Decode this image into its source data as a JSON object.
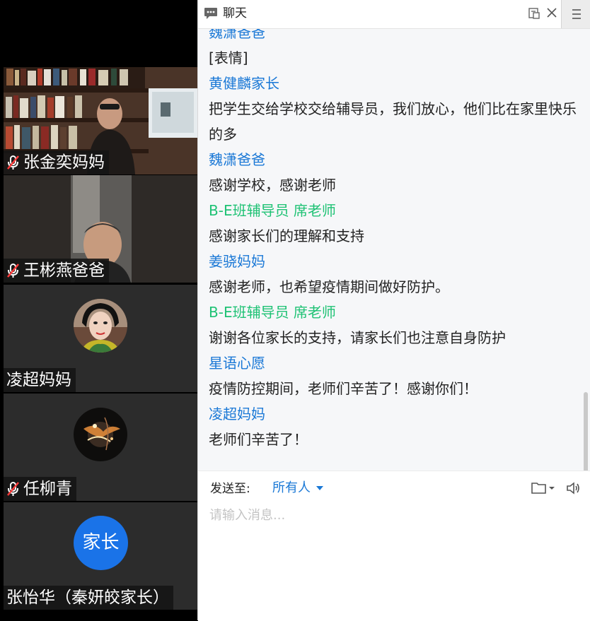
{
  "participants": [
    {
      "name": "张金奕妈妈",
      "muted": true,
      "video": "bookshelf"
    },
    {
      "name": "王彬燕爸爸",
      "muted": true,
      "video": "camera"
    },
    {
      "name": "凌超妈妈",
      "muted": false,
      "video": "avatar"
    },
    {
      "name": "任柳青",
      "muted": true,
      "video": "avatar"
    },
    {
      "name": "张怡华（秦妍皎家长）",
      "muted": false,
      "video": "badge",
      "badge": "家长"
    }
  ],
  "chat": {
    "title": "聊天",
    "messages": [
      {
        "sender": "魏潇爸爸",
        "text": "[表情]"
      },
      {
        "sender": "黄健麟家长",
        "text": "把学生交给学校交给辅导员，我们放心，他们比在家里快乐的多"
      },
      {
        "sender": "魏潇爸爸",
        "text": "感谢学校，感谢老师"
      },
      {
        "sender": "B-E班辅导员 席老师",
        "text": "感谢家长们的理解和支持"
      },
      {
        "sender": "姜骁妈妈",
        "text": "感谢老师，也希望疫情期间做好防护。"
      },
      {
        "sender": "B-E班辅导员 席老师",
        "text": "谢谢各位家长的支持，请家长们也注意自身防护"
      },
      {
        "sender": "星语心愿",
        "text": "疫情防控期间，老师们辛苦了！感谢你们！"
      },
      {
        "sender": "凌超妈妈",
        "text": "老师们辛苦了！"
      }
    ],
    "compose": {
      "send_to_label": "发送至:",
      "recipient": "所有人",
      "placeholder": "请输入消息..."
    }
  },
  "colors": {
    "sender": "#1a78d6",
    "staff_sender": "#1ec274",
    "badge": "#1a73e8"
  },
  "icons": [
    "chat-icon",
    "popout-icon",
    "close-icon",
    "menu-icon",
    "mic-muted-icon",
    "folder-icon",
    "speaker-icon"
  ]
}
